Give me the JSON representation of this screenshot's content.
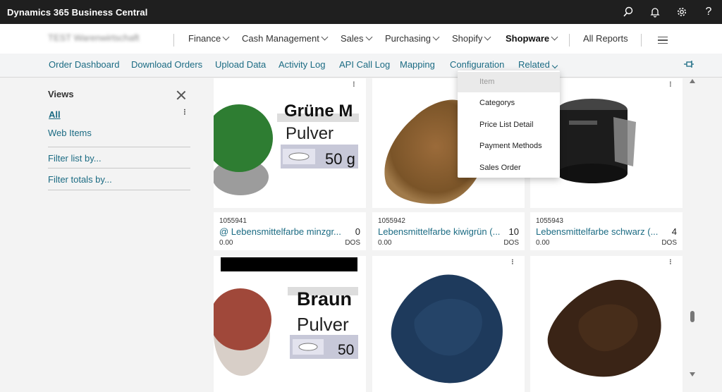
{
  "app": {
    "title": "Dynamics 365 Business Central"
  },
  "topbar": {
    "icons": [
      "search-icon",
      "bell-icon",
      "gear-icon",
      "help-icon"
    ],
    "help_glyph": "?"
  },
  "rolecenter": {
    "company": "TEST Warenwirtschaft",
    "nav": [
      "Finance",
      "Cash Management",
      "Sales",
      "Purchasing",
      "Shopify",
      "Shopware"
    ],
    "all_reports": "All Reports"
  },
  "actions": [
    "Order Dashboard",
    "Download Orders",
    "Upload Data",
    "Activity Log",
    "API Call Log",
    "Mapping",
    "Configuration",
    "Related"
  ],
  "related_menu": [
    "Item",
    "Categorys",
    "Price List Detail",
    "Payment Methods",
    "Sales Order"
  ],
  "views": {
    "title": "Views",
    "all": "All",
    "web_items": "Web Items",
    "filter_list": "Filter list by...",
    "filter_totals": "Filter totals by..."
  },
  "tiles": [
    {
      "no": "1055941",
      "desc": "@ Lebensmittelfarbe minzgr...",
      "qty": "0",
      "price": "0.00",
      "unit": "DOS",
      "label1": "Grüne M",
      "label2": "Pulver",
      "label3": "50 g"
    },
    {
      "no": "1055942",
      "desc": "Lebensmittelfarbe kiwigrün (...",
      "qty": "10",
      "price": "0.00",
      "unit": "DOS"
    },
    {
      "no": "1055943",
      "desc": "Lebensmittelfarbe schwarz (...",
      "qty": "4",
      "price": "0.00",
      "unit": "DOS"
    },
    {
      "label1": "Braun",
      "label2": "Pulver",
      "label3": "50"
    }
  ],
  "colors": {
    "topbar": "#1f1f1f",
    "link": "#1b6b83",
    "green": "#2e7d32",
    "brown_dot": "#a0483a"
  }
}
